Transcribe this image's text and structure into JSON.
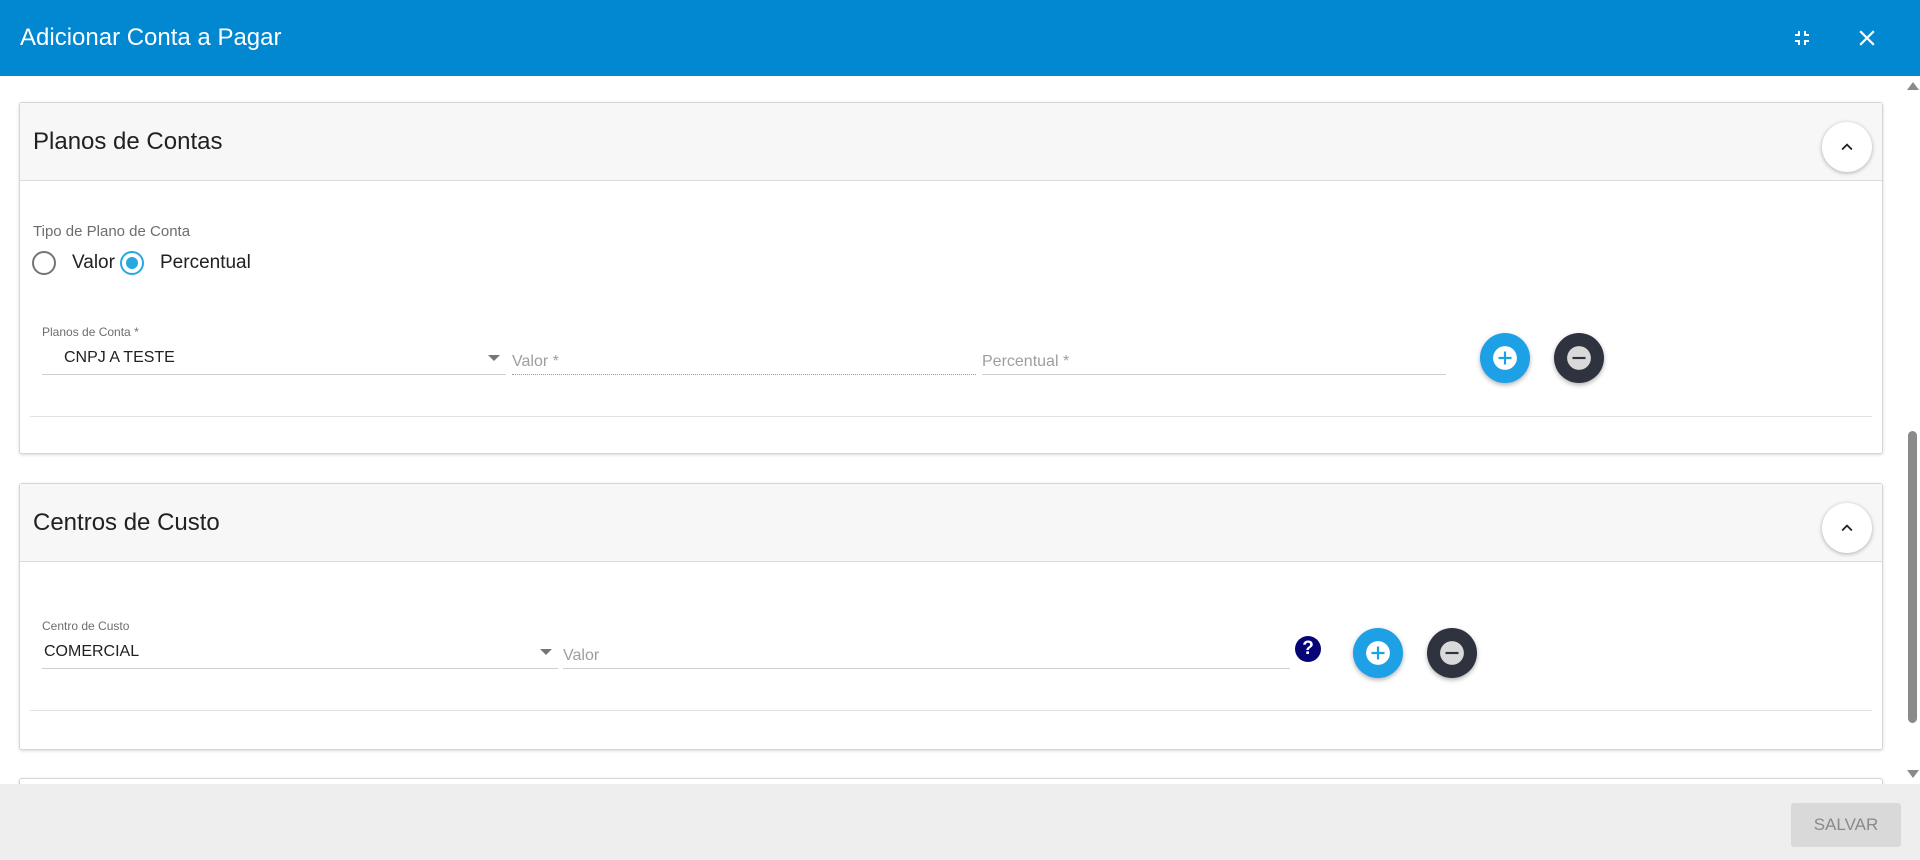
{
  "header": {
    "title": "Adicionar Conta a Pagar"
  },
  "plano_contas": {
    "title": "Planos de Contas",
    "tipo_label": "Tipo de Plano de Conta",
    "radio_valor": "Valor",
    "radio_percentual": "Percentual",
    "selected_tipo": "Percentual",
    "select_label": "Planos de Conta *",
    "select_value": "CNPJ A TESTE",
    "valor_placeholder": "Valor *",
    "percentual_placeholder": "Percentual *"
  },
  "centro_custo": {
    "title": "Centros de Custo",
    "select_label": "Centro de Custo",
    "select_value": "COMERCIAL",
    "valor_placeholder": "Valor"
  },
  "footer": {
    "save_label": "SALVAR"
  },
  "colors": {
    "header_bg": "#0288d1",
    "accent": "#29a8e0",
    "fab_remove": "#2f3340",
    "help_icon": "#050575"
  }
}
